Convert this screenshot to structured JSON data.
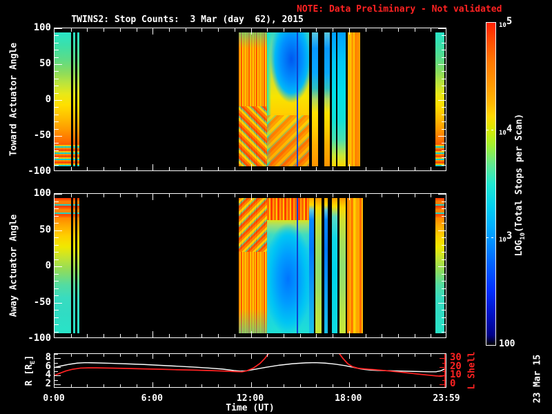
{
  "title": {
    "main": "TWINS2: Stop Counts:  3 Mar (day  62), 2015",
    "note": "NOTE: Data Preliminary - Not validated"
  },
  "date_stamp": "23 Mar 15",
  "colors": {
    "background": "#000000",
    "foreground": "#ffffff",
    "note_red": "#ff2222",
    "r_line": "#ffffff",
    "l_shell_line": "#ff2222",
    "vline_blue": "#1040d0"
  },
  "time_axis": {
    "label": "Time (UT)",
    "range_h": [
      0,
      24
    ],
    "tick_hours": [
      0,
      6,
      12,
      18,
      24
    ],
    "tick_labels": [
      "0:00",
      "6:00",
      "12:00",
      "18:00",
      "23:59"
    ],
    "minor_every_h": 1
  },
  "chart_data": [
    {
      "type": "heatmap",
      "name": "toward",
      "ylabel": "Toward Actuator Angle",
      "ylim": [
        -100,
        100
      ],
      "yticks": [
        100,
        50,
        0,
        -50,
        -100
      ],
      "y_minor_step": 10,
      "bands": [
        {
          "start": 0.0,
          "end": 1.02,
          "style": "tw-main"
        },
        {
          "start": 1.14,
          "end": 1.27,
          "style": "tw-main"
        },
        {
          "start": 1.39,
          "end": 1.52,
          "style": "tw-main"
        },
        {
          "start": 11.32,
          "end": 13.05,
          "style": "warm-noise"
        },
        {
          "start": 13.05,
          "end": 15.6,
          "style": "tw-smooth"
        },
        {
          "start": 15.77,
          "end": 16.19,
          "style": "tw-col"
        },
        {
          "start": 16.53,
          "end": 16.87,
          "style": "tw-col"
        },
        {
          "start": 17.0,
          "end": 17.25,
          "style": "cool-col"
        },
        {
          "start": 17.37,
          "end": 17.88,
          "style": "cool-col"
        },
        {
          "start": 18.0,
          "end": 18.76,
          "style": "warm-band"
        },
        {
          "start": 23.35,
          "end": 23.93,
          "style": "tw-main"
        }
      ],
      "vlines": [
        {
          "h": 14.85,
          "style": "vline-blue"
        }
      ]
    },
    {
      "type": "heatmap",
      "name": "away",
      "ylabel": "Away Actuator Angle",
      "ylim": [
        -100,
        100
      ],
      "yticks": [
        100,
        50,
        0,
        -50,
        -100
      ],
      "y_minor_step": 10,
      "bands": [
        {
          "start": 0.0,
          "end": 1.02,
          "style": "aw-main"
        },
        {
          "start": 1.14,
          "end": 1.27,
          "style": "aw-main"
        },
        {
          "start": 1.39,
          "end": 1.52,
          "style": "aw-main"
        },
        {
          "start": 11.32,
          "end": 13.05,
          "style": "warm-noise2"
        },
        {
          "start": 13.05,
          "end": 15.6,
          "style": "aw-smooth"
        },
        {
          "start": 15.62,
          "end": 15.9,
          "style": "cool-col2"
        },
        {
          "start": 16.02,
          "end": 16.4,
          "style": "green-col"
        },
        {
          "start": 16.53,
          "end": 16.78,
          "style": "cool-col2"
        },
        {
          "start": 17.0,
          "end": 17.37,
          "style": "cyan-col"
        },
        {
          "start": 17.5,
          "end": 17.88,
          "style": "green-col"
        },
        {
          "start": 17.95,
          "end": 18.9,
          "style": "warm-band2"
        },
        {
          "start": 23.35,
          "end": 23.93,
          "style": "aw-main"
        }
      ],
      "vlines": [
        {
          "h": 14.85,
          "style": "vline-blue"
        }
      ]
    },
    {
      "type": "line",
      "name": "orbit",
      "left_axis": {
        "label_pre": "R [R",
        "label_sub": "E",
        "label_post": "]",
        "ticks": [
          8,
          6,
          4,
          2
        ],
        "minor": [
          3,
          5,
          7,
          9
        ],
        "range": [
          1,
          9
        ],
        "color": "#ffffff"
      },
      "right_axis": {
        "label": "L Shell",
        "ticks": [
          30,
          20,
          10,
          0
        ],
        "minor": [
          5,
          15,
          25
        ],
        "range": [
          -5,
          35
        ],
        "color": "#ff2222"
      },
      "series": [
        {
          "name": "R",
          "color": "#ffffff",
          "axis": "left",
          "segments": [
            [
              [
                0,
                5.75
              ],
              [
                0.4,
                6.1
              ],
              [
                0.9,
                6.5
              ],
              [
                1.4,
                6.8
              ],
              [
                1.9,
                6.9
              ],
              [
                2.5,
                6.85
              ],
              [
                3.5,
                6.75
              ],
              [
                4.5,
                6.6
              ],
              [
                5.5,
                6.45
              ],
              [
                6.5,
                6.25
              ],
              [
                7.5,
                6.05
              ],
              [
                8.5,
                5.85
              ],
              [
                9.5,
                5.6
              ],
              [
                10.3,
                5.35
              ],
              [
                11,
                5.0
              ],
              [
                11.4,
                4.85
              ],
              [
                11.8,
                4.95
              ],
              [
                12.3,
                5.3
              ],
              [
                13,
                5.8
              ],
              [
                13.8,
                6.3
              ],
              [
                14.6,
                6.65
              ],
              [
                15.4,
                6.85
              ],
              [
                16,
                6.9
              ],
              [
                16.6,
                6.8
              ],
              [
                17.2,
                6.55
              ],
              [
                17.8,
                6.2
              ],
              [
                18.3,
                5.8
              ],
              [
                18.7,
                5.45
              ],
              [
                19,
                5.25
              ],
              [
                19.4,
                5.1
              ],
              [
                20,
                5.0
              ],
              [
                21,
                4.9
              ],
              [
                22,
                4.8
              ],
              [
                23,
                4.7
              ],
              [
                23.4,
                4.7
              ],
              [
                23.7,
                4.95
              ],
              [
                24,
                5.5
              ]
            ]
          ]
        },
        {
          "name": "L Shell",
          "color": "#ff2222",
          "axis": "right",
          "segments": [
            [
              [
                0,
                9.0
              ],
              [
                0.3,
                11.5
              ],
              [
                0.7,
                14.5
              ],
              [
                1.1,
                16.5
              ],
              [
                1.6,
                18.0
              ],
              [
                2.1,
                18.3
              ],
              [
                2.6,
                18.2
              ],
              [
                3.5,
                17.9
              ],
              [
                4.5,
                17.5
              ],
              [
                5.5,
                17.0
              ],
              [
                6.5,
                16.5
              ],
              [
                7.5,
                16.0
              ],
              [
                8.5,
                15.5
              ],
              [
                9.5,
                15.0
              ],
              [
                10.4,
                14.4
              ],
              [
                11.1,
                13.7
              ],
              [
                11.5,
                13.4
              ],
              [
                11.8,
                14.8
              ],
              [
                12.2,
                18.0
              ],
              [
                12.6,
                23.5
              ],
              [
                12.9,
                29.5
              ],
              [
                13.15,
                36.0
              ]
            ],
            [
              [
                17.45,
                36.0
              ],
              [
                17.7,
                29.5
              ],
              [
                18.0,
                23.0
              ],
              [
                18.3,
                19.5
              ],
              [
                18.6,
                17.8
              ],
              [
                19,
                17.0
              ],
              [
                19.5,
                16.3
              ],
              [
                20,
                15.4
              ],
              [
                20.5,
                14.5
              ],
              [
                21,
                13.5
              ],
              [
                21.5,
                12.5
              ],
              [
                22,
                11.4
              ],
              [
                22.5,
                10.3
              ],
              [
                23,
                9.3
              ],
              [
                23.4,
                8.5
              ],
              [
                23.7,
                8.1
              ],
              [
                24,
                9.2
              ]
            ]
          ]
        }
      ]
    }
  ],
  "colorbar": {
    "label_pre": "LOG",
    "label_sub": "10",
    "label_post": "(Total Stops per Scan)",
    "ticks": [
      {
        "pos": 1.0,
        "label": "10^5"
      },
      {
        "pos": 0.667,
        "label": "10^4"
      },
      {
        "pos": 0.333,
        "label": "10^3"
      },
      {
        "pos": 0.0,
        "label": "100"
      }
    ],
    "gradient": [
      "#000000 0%",
      "#000088 3%",
      "#0010c0 9%",
      "#0030ff 17%",
      "#0068ff 26%",
      "#0098ff 33%",
      "#00b0ff 37%",
      "#00d0f0 43%",
      "#20e8d0 50%",
      "#60e890 56%",
      "#a0f030 62%",
      "#d8e800 67%",
      "#ffd800 71%",
      "#ffb800 75%",
      "#ff9800 81%",
      "#ff7800 88%",
      "#ff5000 94%",
      "#ff2000 100%"
    ]
  }
}
